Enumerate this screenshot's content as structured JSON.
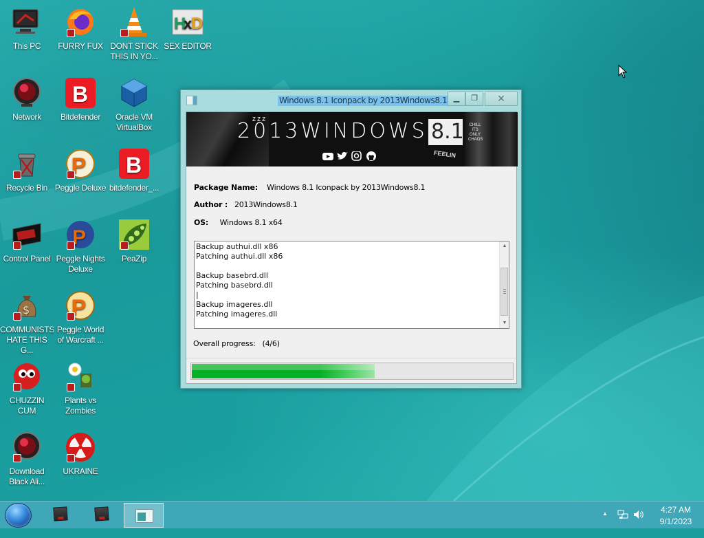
{
  "desktop": {
    "icons": [
      {
        "label": "This PC",
        "icon": "monitor-icon"
      },
      {
        "label": "Network",
        "icon": "red-orb-icon"
      },
      {
        "label": "Recycle Bin",
        "icon": "recycle-bin-icon"
      },
      {
        "label": "Control Panel",
        "icon": "control-panel-icon"
      },
      {
        "label": "COMMUNISTS HATE THIS G...",
        "icon": "money-bag-icon"
      },
      {
        "label": "CHUZZIN CUM",
        "icon": "chuzzle-icon"
      },
      {
        "label": "Download Black Ali...",
        "icon": "red-orb-icon"
      },
      {
        "label": "FURRY FUX",
        "icon": "firefox-icon"
      },
      {
        "label": "Bitdefender",
        "icon": "bitdefender-icon"
      },
      {
        "label": "Peggle Deluxe",
        "icon": "peggle-icon"
      },
      {
        "label": "Peggle Nights Deluxe",
        "icon": "peggle-nights-icon"
      },
      {
        "label": "Peggle World of Warcraft ...",
        "icon": "peggle-icon"
      },
      {
        "label": "Plants vs Zombies",
        "icon": "pvz-icon"
      },
      {
        "label": "UKRAINE",
        "icon": "radiation-icon"
      },
      {
        "label": "DONT STICK THIS IN YO...",
        "icon": "vlc-cone-icon"
      },
      {
        "label": "Oracle VM VirtualBox",
        "icon": "virtualbox-icon"
      },
      {
        "label": "bitdefender_...",
        "icon": "bitdefender-icon"
      },
      {
        "label": "PeaZip",
        "icon": "peazip-icon"
      },
      {
        "label": "SEX EDITOR",
        "icon": "hxd-icon"
      }
    ]
  },
  "window": {
    "title": "Windows 8.1 Iconpack by 2013Windows8.1",
    "banner": {
      "brand_text": "2013WINDOWS",
      "brand_suffix": "8.1"
    },
    "package_name_label": "Package Name:",
    "package_name_value": "Windows 8.1 Iconpack by 2013Windows8.1",
    "author_label": "Author :",
    "author_value": "2013Windows8.1",
    "os_label": "OS:",
    "os_value": "Windows 8.1 x64",
    "log_lines": [
      "Backup authui.dll x86",
      "Patching authui.dll x86",
      "",
      "Backup basebrd.dll",
      "Patching basebrd.dll",
      "|",
      "Backup imageres.dll",
      "Patching imageres.dll"
    ],
    "overall_label": "Overall progress:",
    "overall_value": "(4/6)",
    "progress_fraction": 0.57,
    "buttons": {
      "minimize": "▁",
      "maximize": "❐",
      "close": "✕"
    }
  },
  "taskbar": {
    "clock_time": "4:27 AM",
    "clock_date": "9/1/2023"
  },
  "colors": {
    "accent": "#1c9c9c",
    "taskbar": "#3fa7b7",
    "progress": "#06b025"
  }
}
